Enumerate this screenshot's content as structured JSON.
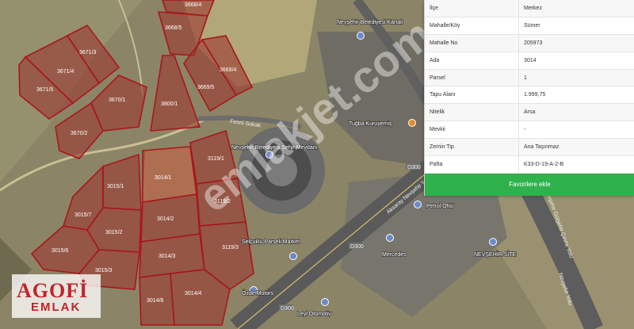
{
  "map": {
    "watermark": "emlakjet.com",
    "parcels": [
      {
        "label": "3668/4"
      },
      {
        "label": "3668/5"
      },
      {
        "label": "3671/3"
      },
      {
        "label": "3671/4"
      },
      {
        "label": "3671/5"
      },
      {
        "label": "3670/1"
      },
      {
        "label": "3670/2"
      },
      {
        "label": "3669/4"
      },
      {
        "label": "3669/5"
      },
      {
        "label": "3800/1"
      },
      {
        "label": "3015/1"
      },
      {
        "label": "3015/7"
      },
      {
        "label": "3015/2"
      },
      {
        "label": "3015/6"
      },
      {
        "label": "3015/3"
      },
      {
        "label": "3014/1"
      },
      {
        "label": "3014/2"
      },
      {
        "label": "3014/3"
      },
      {
        "label": "3014/8"
      },
      {
        "label": "3014/4"
      },
      {
        "label": "3119/1"
      },
      {
        "label": "3119/2"
      },
      {
        "label": "3119/3"
      }
    ],
    "pois": [
      {
        "label": "Nevşehir Belediyesi Kartalı"
      },
      {
        "label": "Nevşehir Belediyesi Şehir Meydanı"
      },
      {
        "label": "Tuğba Kuruyemiş"
      },
      {
        "label": "Petrol Ofisi"
      },
      {
        "label": "Selçuklu Parseli Market"
      },
      {
        "label": "Mercedes"
      },
      {
        "label": "NEVŞEHİR SİTE"
      },
      {
        "label": "Özde Motors"
      },
      {
        "label": "Leyl Otomotiv"
      }
    ],
    "roads": [
      {
        "label": "Aksaray Nevşehir Yolu"
      },
      {
        "label": "Nevşehir Gülşehir Çevre Yolu"
      },
      {
        "label": "Nevşehir Yolu"
      },
      {
        "label": "Fenni Sokak"
      },
      {
        "label": "D300"
      },
      {
        "label": "D300"
      },
      {
        "label": "D300"
      }
    ]
  },
  "info_panel": {
    "rows": [
      {
        "key": "İlçe",
        "value": "Merkez"
      },
      {
        "key": "Mahalle/Köy",
        "value": "Sümer"
      },
      {
        "key": "Mahalle No",
        "value": "205973"
      },
      {
        "key": "Ada",
        "value": "3014"
      },
      {
        "key": "Parsel",
        "value": "1"
      },
      {
        "key": "Tapu Alanı",
        "value": "1.999,75"
      },
      {
        "key": "Nitelik",
        "value": "Arsa"
      },
      {
        "key": "Mevkii",
        "value": "-"
      },
      {
        "key": "Zemin Tip",
        "value": "Ana Taşınmaz"
      },
      {
        "key": "Pafta",
        "value": "K33-D-19-A-2-B"
      }
    ],
    "button_label": "Favorilere ekle"
  },
  "logo": {
    "line1": "AGOFİ",
    "line2": "EMLAK"
  },
  "colors": {
    "parcel_stroke": "#a8171b",
    "parcel_fill": "#9b3a32",
    "selected_fill": "#d8d08a",
    "button": "#2fb24c"
  }
}
